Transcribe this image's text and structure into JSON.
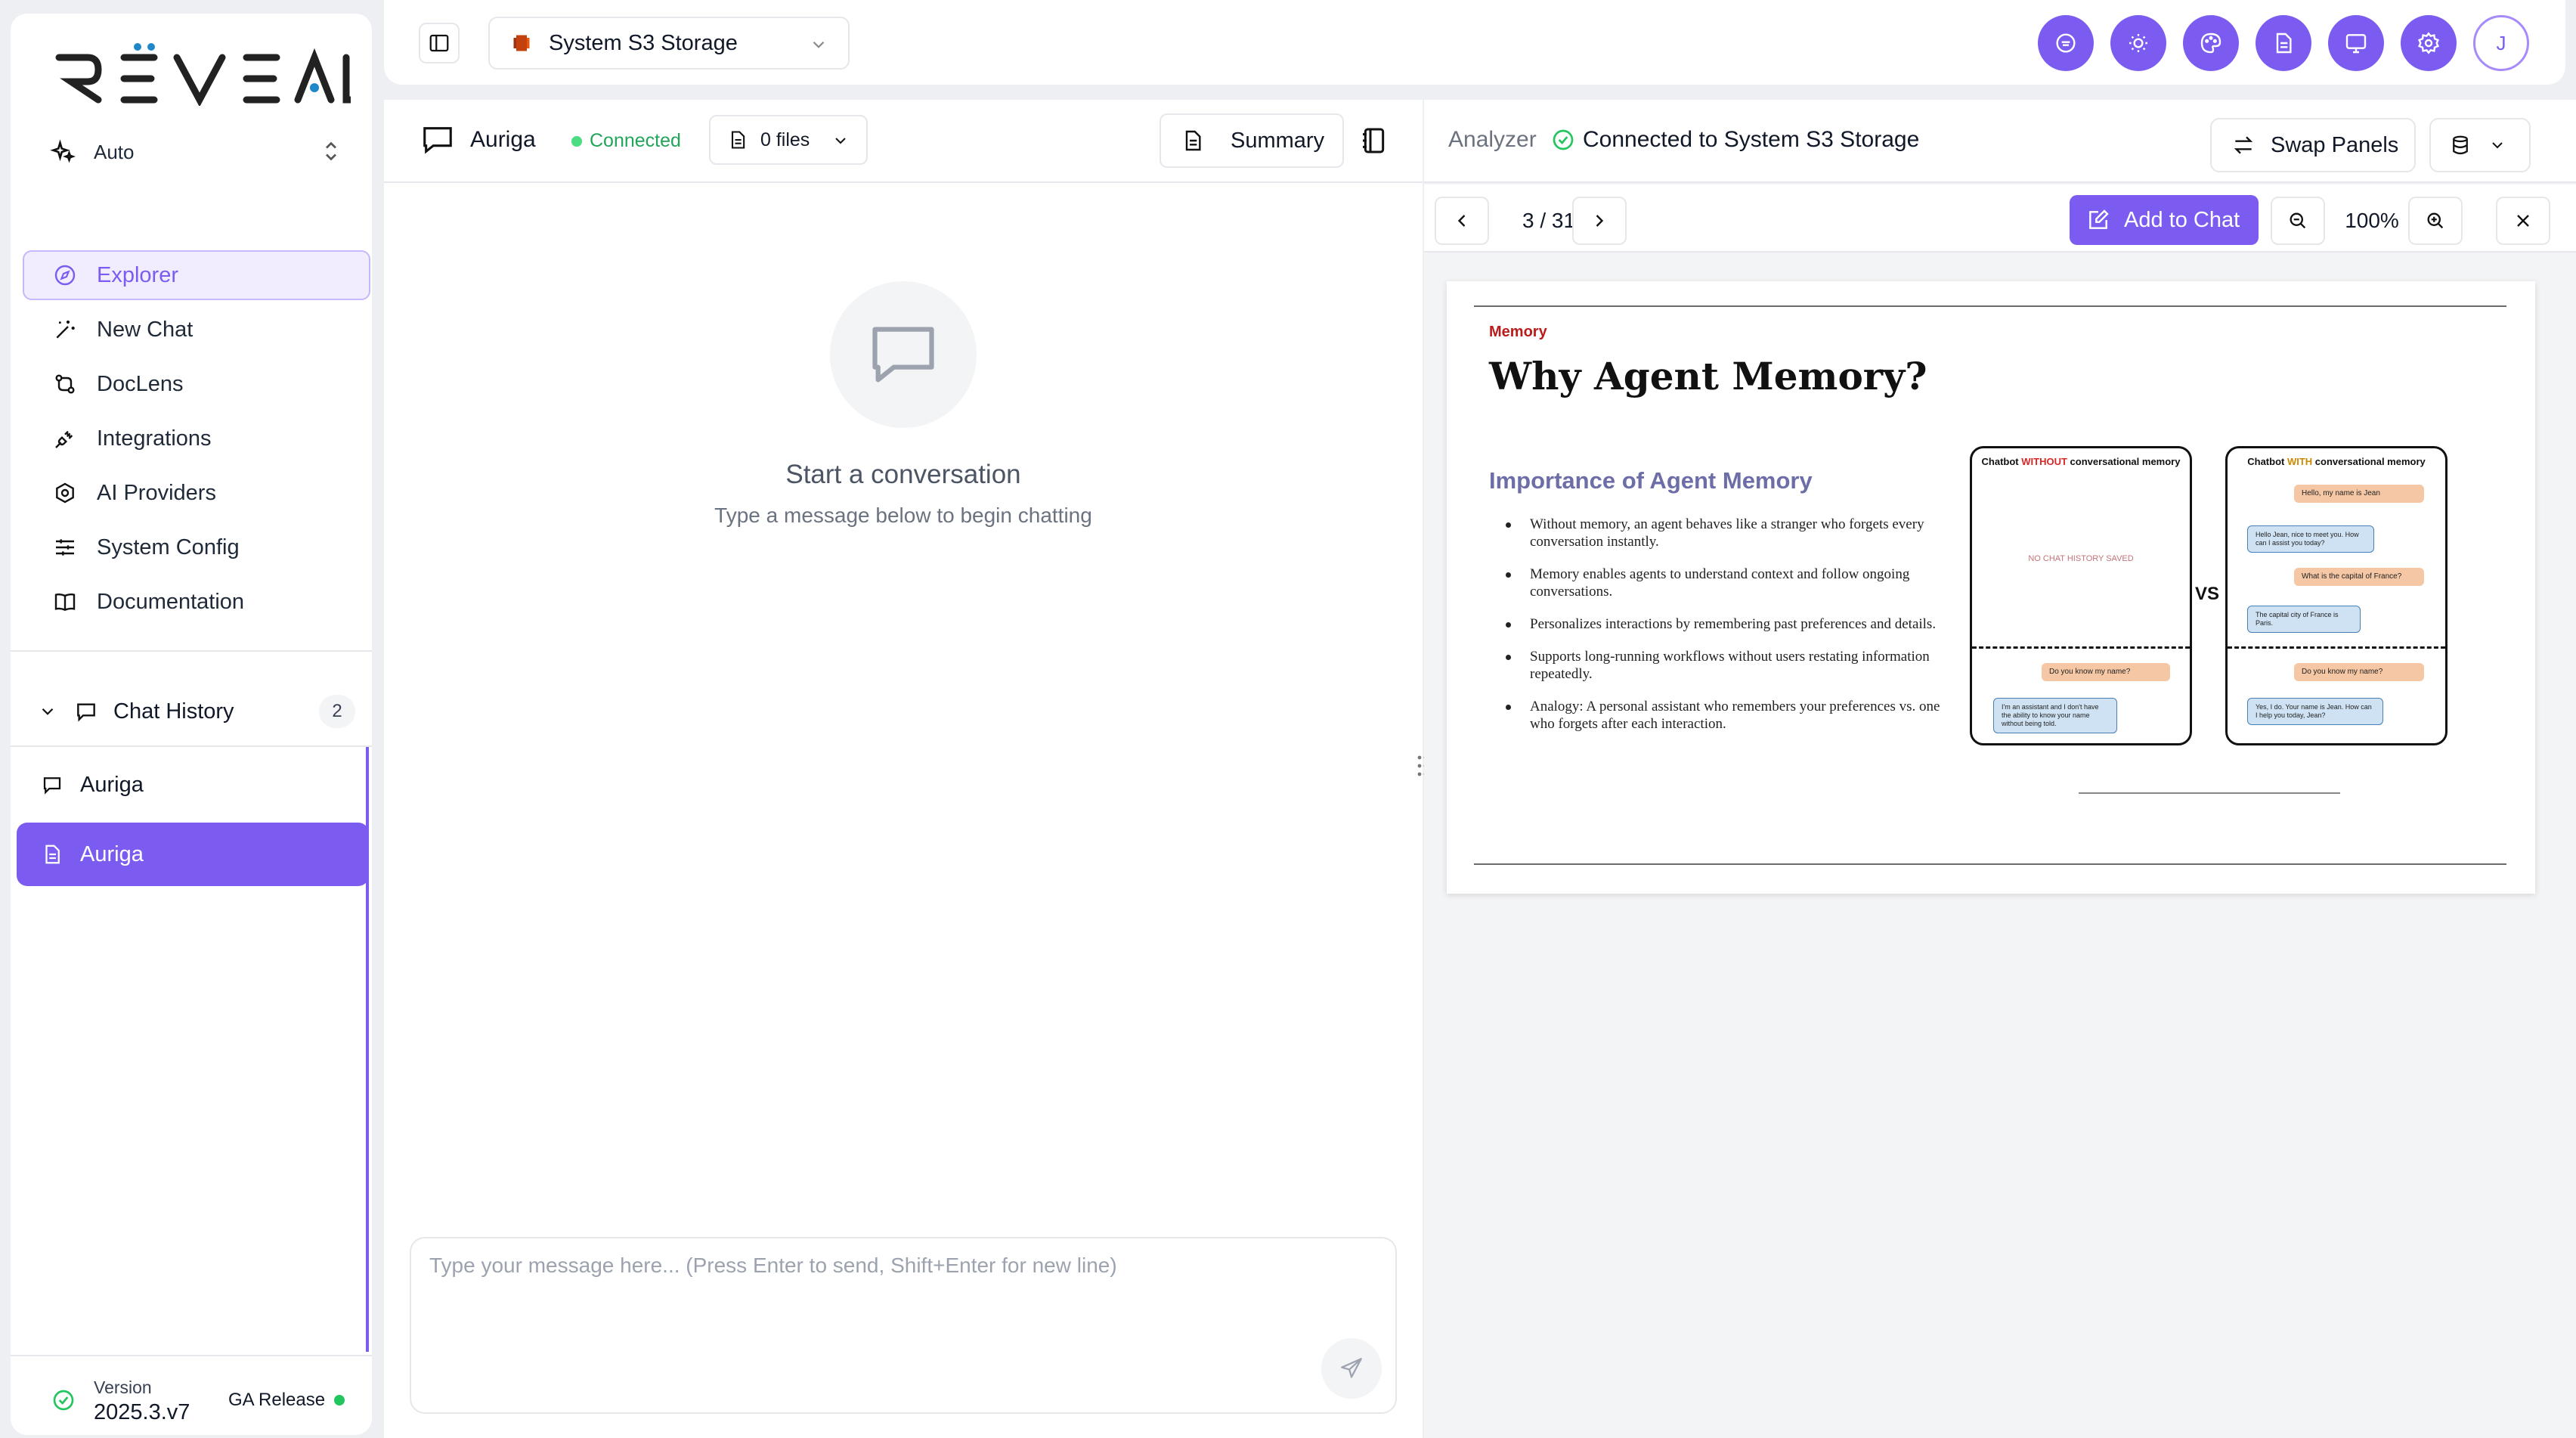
{
  "sidebar": {
    "brand": "REVEAL",
    "mode": "Auto",
    "nav": [
      {
        "label": "Explorer",
        "icon": "compass-icon"
      },
      {
        "label": "New Chat",
        "icon": "magic-wand-icon"
      },
      {
        "label": "DocLens",
        "icon": "doclens-icon"
      },
      {
        "label": "Integrations",
        "icon": "plug-icon"
      },
      {
        "label": "AI Providers",
        "icon": "hexagon-icon"
      },
      {
        "label": "System Config",
        "icon": "sliders-icon"
      },
      {
        "label": "Documentation",
        "icon": "book-icon"
      }
    ],
    "chat_history": {
      "title": "Chat History",
      "count": "2",
      "items": [
        {
          "label": "Auriga",
          "icon": "message-icon"
        },
        {
          "label": "Auriga",
          "icon": "document-icon"
        }
      ]
    },
    "version": {
      "label": "Version",
      "value": "2025.3.v7",
      "release": "GA Release"
    }
  },
  "topbar": {
    "storage": "System S3 Storage",
    "avatar_initial": "J",
    "actions": [
      "chat-bubble-icon",
      "sun-icon",
      "palette-icon",
      "file-text-icon",
      "monitor-message-icon",
      "gear-icon"
    ]
  },
  "chat": {
    "title": "Auriga",
    "status": "Connected",
    "files": "0 files",
    "summary": "Summary",
    "empty_title": "Start a conversation",
    "empty_subtitle": "Type a message below to begin chatting",
    "input_placeholder": "Type your message here... (Press Enter to send, Shift+Enter for new line)"
  },
  "analyzer": {
    "label": "Analyzer",
    "status": "Connected to System S3 Storage",
    "swap": "Swap Panels",
    "page": "3 / 31",
    "add_to_chat": "Add to Chat",
    "zoom": "100%"
  },
  "slide": {
    "kicker": "Memory",
    "title": "Why Agent Memory?",
    "subtitle": "Importance of Agent Memory",
    "bullets": [
      "Without memory, an agent behaves like a stranger who forgets every conversation instantly.",
      "Memory enables agents to understand context and follow ongoing conversations.",
      "Personalizes interactions by remembering past preferences and details.",
      "Supports long-running workflows without users restating information repeatedly.",
      "Analogy: A personal assistant who remembers your preferences vs. one who forgets after each interaction."
    ],
    "vs": "VS",
    "left_phone": {
      "title_a": "Chatbot ",
      "title_b": "WITHOUT",
      "title_c": " conversational memory",
      "no_history": "NO CHAT HISTORY SAVED",
      "q": "Do you know my name?",
      "a": "I'm an assistant and I don't have the ability to know your name without being told."
    },
    "right_phone": {
      "title_a": "Chatbot ",
      "title_b": "WITH",
      "title_c": " conversational memory",
      "m1": "Hello, my name is Jean",
      "m2": "Hello Jean, nice to meet you. How can I assist you today?",
      "m3": "What is the capital of France?",
      "m4": "The capital city of France is Paris.",
      "q": "Do you know my name?",
      "a": "Yes, I do. Your name is Jean. How can I help you today, Jean?"
    }
  },
  "colors": {
    "accent": "#7c5cf0",
    "connected": "#22a55a",
    "slide_kicker": "#b91c1c",
    "slide_subtitle": "#6d6ea8"
  }
}
